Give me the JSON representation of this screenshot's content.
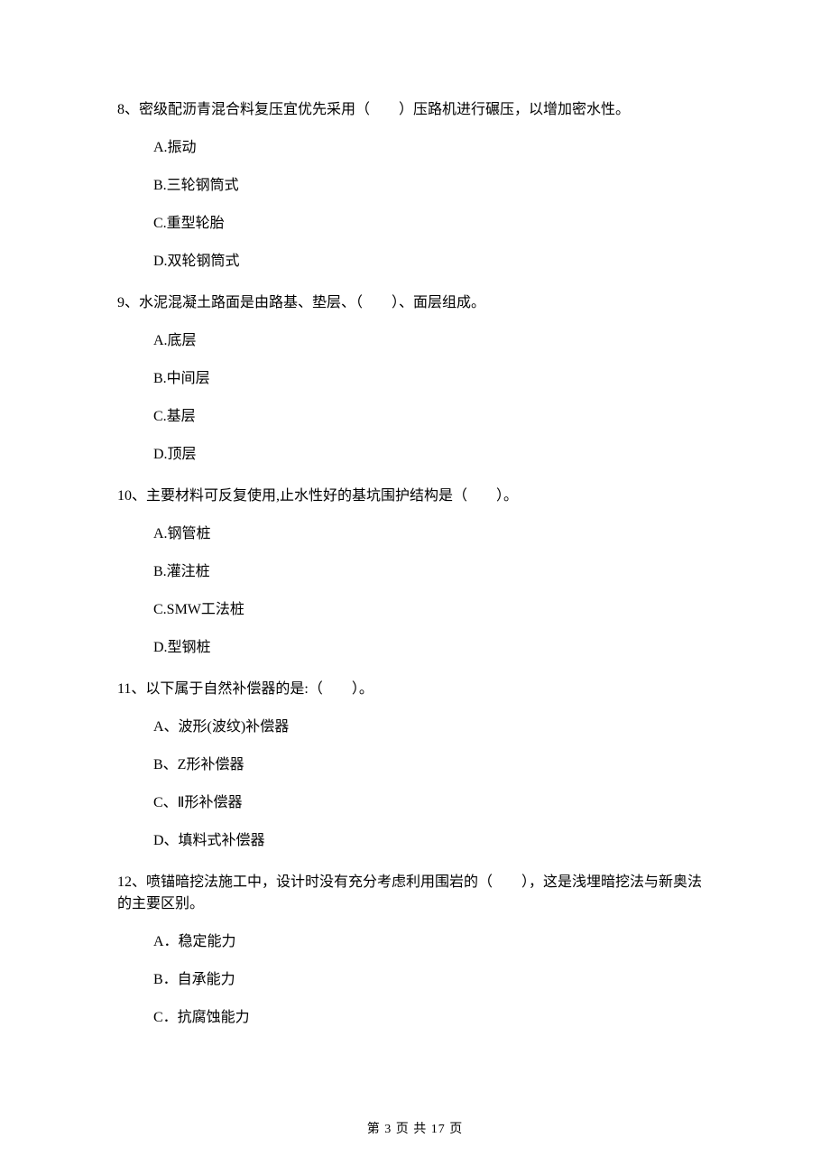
{
  "questions": [
    {
      "number": "8、",
      "text": "密级配沥青混合料复压宜优先采用（　　）压路机进行碾压，以增加密水性。",
      "options": [
        "A.振动",
        "B.三轮钢筒式",
        "C.重型轮胎",
        "D.双轮钢筒式"
      ]
    },
    {
      "number": "9、",
      "text": "水泥混凝土路面是由路基、垫层、（　　）、面层组成。",
      "options": [
        "A.底层",
        "B.中间层",
        "C.基层",
        "D.顶层"
      ]
    },
    {
      "number": "10、",
      "text": "主要材料可反复使用,止水性好的基坑围护结构是（　　）。",
      "options": [
        "A.钢管桩",
        "B.灌注桩",
        "C.SMW工法桩",
        "D.型钢桩"
      ]
    },
    {
      "number": "11、",
      "text": "以下属于自然补偿器的是:（　　）。",
      "options": [
        "A、波形(波纹)补偿器",
        "B、Z形补偿器",
        "C、Ⅱ形补偿器",
        "D、填料式补偿器"
      ]
    },
    {
      "number": "12、",
      "text": "喷锚暗挖法施工中，设计时没有充分考虑利用围岩的（　　），这是浅埋暗挖法与新奥法的主要区别。",
      "options": [
        "A．稳定能力",
        "B．自承能力",
        "C．抗腐蚀能力"
      ]
    }
  ],
  "footer": "第 3 页 共 17 页"
}
